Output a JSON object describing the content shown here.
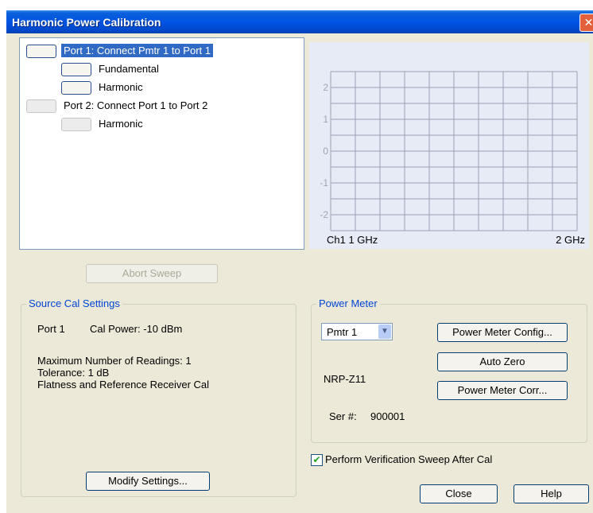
{
  "window": {
    "title": "Harmonic Power Calibration"
  },
  "tree": [
    {
      "label": "Port 1: Connect Pmtr 1 to Port 1",
      "selected": true
    },
    {
      "label": "Fundamental"
    },
    {
      "label": "Harmonic"
    },
    {
      "label": "Port 2: Connect Port 1 to Port 2",
      "disabled": true
    },
    {
      "label": "Harmonic",
      "disabled": true
    }
  ],
  "chart_data": {
    "type": "line",
    "series": [],
    "ylim": [
      -2.5,
      2.5
    ],
    "yticks": [
      "2",
      "1",
      "0",
      "-1",
      "-2"
    ],
    "channel_label": "Ch1",
    "start_label": "1 GHz",
    "stop_label": "2 GHz",
    "grid": true,
    "vertical_divisions": 10,
    "horizontal_divisions": 10
  },
  "abort_button": {
    "label": "Abort Sweep"
  },
  "source_cal": {
    "title": "Source Cal Settings",
    "port": "Port 1",
    "cal_power": "Cal Power:  -10 dBm",
    "line1": "Maximum Number of Readings: 1",
    "line2": "Tolerance: 1 dB",
    "line3": "Flatness and Reference Receiver Cal",
    "modify_label": "Modify Settings..."
  },
  "power_meter": {
    "title": "Power Meter",
    "selected": "Pmtr 1",
    "model": "NRP-Z11",
    "ser_label": "Ser #:",
    "ser_value": "900001",
    "config_label": "Power Meter Config...",
    "auto_zero_label": "Auto Zero",
    "corr_label": "Power Meter Corr..."
  },
  "verification": {
    "label": "Perform Verification Sweep After Cal",
    "checked": true
  },
  "buttons": {
    "close": "Close",
    "help": "Help"
  },
  "colors": {
    "titlebar": "#0054e3",
    "selection": "#316ac5",
    "group_title": "#0046d5",
    "chart_bg": "#e7ebf6"
  }
}
